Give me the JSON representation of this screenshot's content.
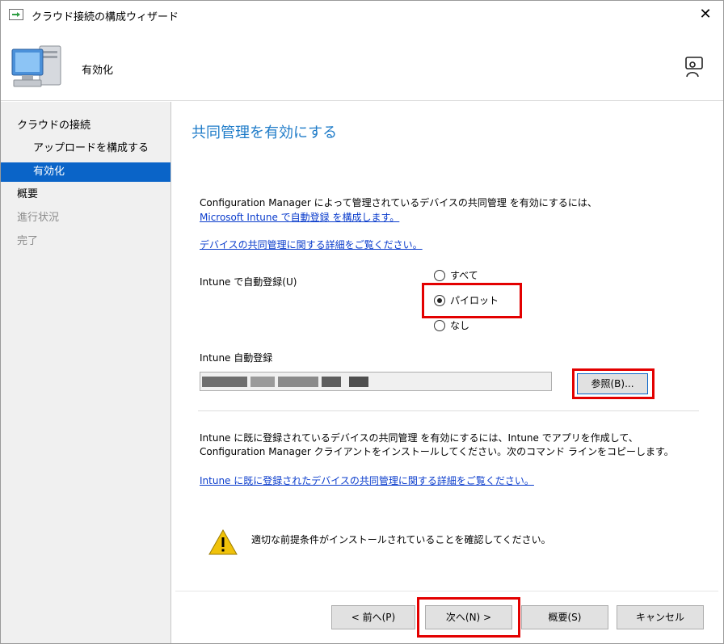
{
  "window": {
    "title": "クラウド接続の構成ウィザード",
    "close_glyph": "✕"
  },
  "header": {
    "title": "有効化"
  },
  "sidebar": {
    "items": [
      {
        "label": "クラウドの接続"
      },
      {
        "label": "アップロードを構成する"
      },
      {
        "label": "有効化"
      },
      {
        "label": "概要"
      },
      {
        "label": "進行状況"
      },
      {
        "label": "完了"
      }
    ]
  },
  "main": {
    "title": "共同管理を有効にする",
    "description1": "Configuration Manager によって管理されているデバイスの共同管理 を有効にするには、",
    "link1": "Microsoft Intune で自動登録 を構成します。",
    "link2": "デバイスの共同管理に関する詳細をご覧ください。",
    "auto_enroll_label": "Intune で自動登録(U)",
    "radio_options": [
      {
        "label": "すべて",
        "checked": false
      },
      {
        "label": "パイロット",
        "checked": true
      },
      {
        "label": "なし",
        "checked": false
      }
    ],
    "auto_enroll_field_label": "Intune 自動登録",
    "auto_enroll_field_value": "",
    "browse_label": "参照(B)...",
    "description2_line1": "Intune に既に登録されているデバイスの共同管理 を有効にするには、Intune でアプリを作成して、",
    "description2_line2": "Configuration Manager クライアントをインストールしてください。次のコマンド ラインをコピーします。",
    "link3": "Intune に既に登録されたデバイスの共同管理に関する詳細をご覧ください。",
    "warning_text": "適切な前提条件がインストールされていることを確認してください。"
  },
  "footer": {
    "back_label": "< 前へ(P)",
    "next_label": "次へ(N) >",
    "summary_label": "概要(S)",
    "cancel_label": "キャンセル"
  },
  "colors": {
    "accent": "#0a64c8",
    "title_blue": "#1e7bc8",
    "link": "#0a3ccc",
    "highlight": "#e30000",
    "warning": "#f0c20a"
  }
}
